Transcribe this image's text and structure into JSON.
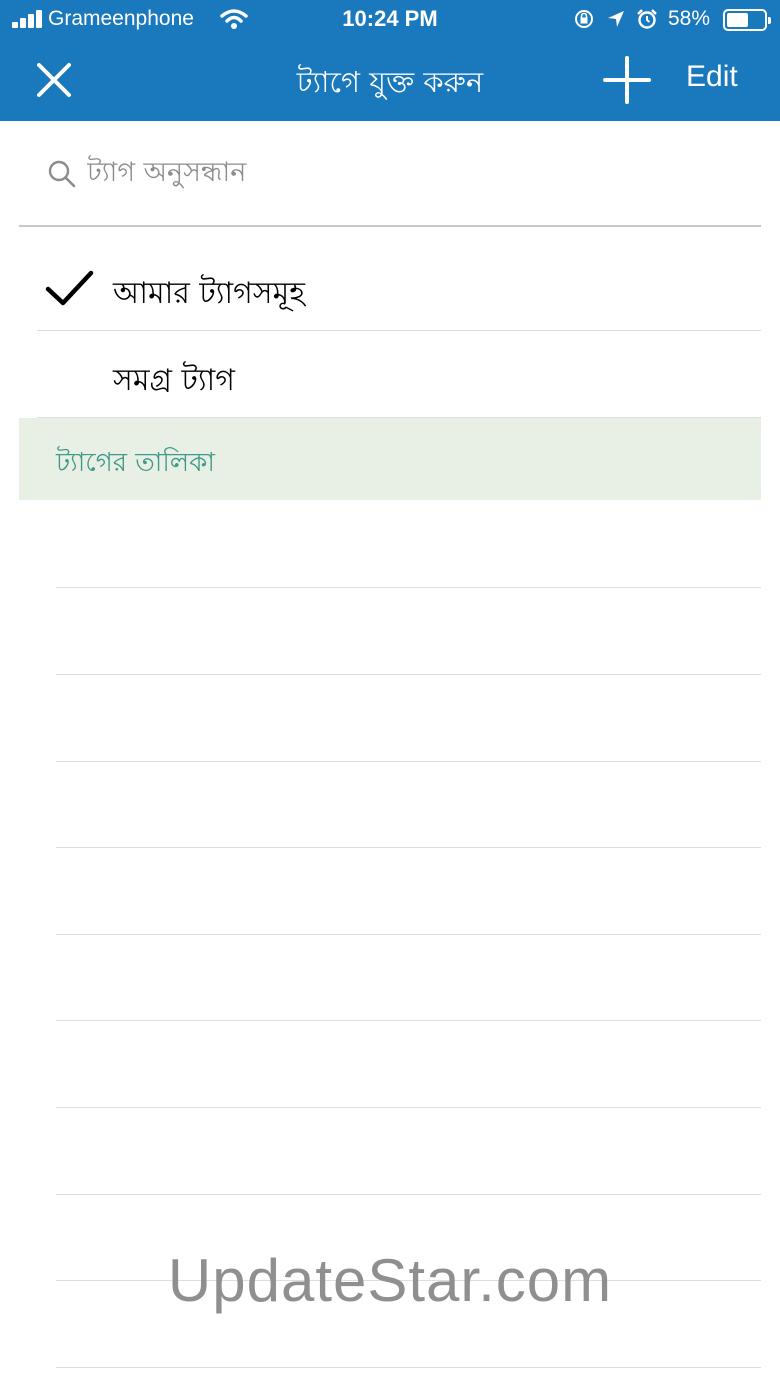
{
  "status_bar": {
    "carrier": "Grameenphone",
    "time": "10:24 PM",
    "battery_percent": "58%",
    "battery_level": 0.58,
    "icons": [
      "signal-icon",
      "wifi-icon",
      "orientation-lock-icon",
      "location-icon",
      "alarm-icon",
      "battery-icon"
    ]
  },
  "nav": {
    "title": "ট্যাগে যুক্ত করুন",
    "close_icon": "close-icon",
    "add_icon": "plus-icon",
    "edit_label": "Edit"
  },
  "search": {
    "placeholder": "ট্যাগ অনুসন্ধান",
    "value": ""
  },
  "filters": [
    {
      "label": "আমার ট্যাগসমূহ",
      "selected": true
    },
    {
      "label": "সমগ্র ট্যাগ",
      "selected": false
    }
  ],
  "section": {
    "title": "ট্যাগের তালিকা"
  },
  "watermark": "UpdateStar.com",
  "colors": {
    "header_bg": "#1a78bd",
    "section_bg": "#e8f0e6",
    "section_text": "#3f9a88"
  }
}
